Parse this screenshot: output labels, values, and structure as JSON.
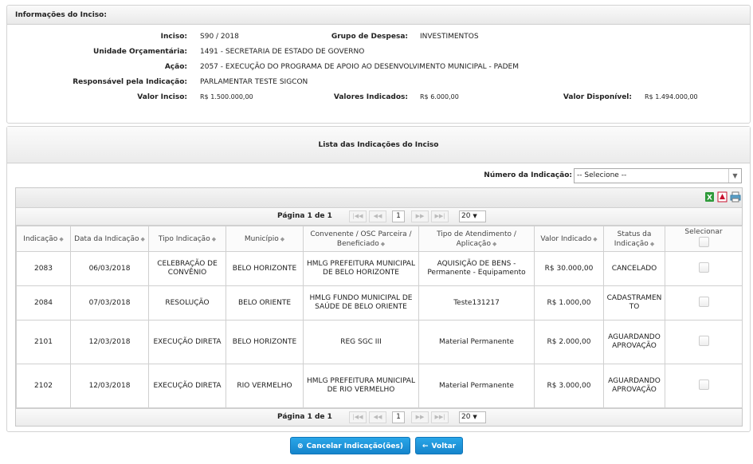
{
  "info": {
    "title": "Informações do Inciso:",
    "inciso_label": "Inciso:",
    "inciso_value": "S90 / 2018",
    "grupo_label": "Grupo de Despesa:",
    "grupo_value": "INVESTIMENTOS",
    "unidade_label": "Unidade Orçamentária:",
    "unidade_value": "1491 - SECRETARIA DE ESTADO DE GOVERNO",
    "acao_label": "Ação:",
    "acao_value": "2057 - EXECUÇÃO DO PROGRAMA DE APOIO AO DESENVOLVIMENTO MUNICIPAL - PADEM",
    "responsavel_label": "Responsável pela Indicação:",
    "responsavel_value": "PARLAMENTAR TESTE SIGCON",
    "valor_inciso_label": "Valor Inciso:",
    "valor_inciso_value": "R$ 1.500.000,00",
    "valores_indicados_label": "Valores Indicados:",
    "valores_indicados_value": "R$ 6.000,00",
    "valor_disponivel_label": "Valor Disponível:",
    "valor_disponivel_value": "R$ 1.494.000,00"
  },
  "list": {
    "title": "Lista das Indicações do Inciso",
    "filter_label": "Número da Indicação:",
    "filter_value": "-- Selecione --",
    "pager_text": "Página 1 de 1",
    "page_input": "1",
    "page_size": "20",
    "columns": [
      "Indicação",
      "Data da Indicação",
      "Tipo Indicação",
      "Município",
      "Convenente / OSC Parceira / Beneficiado",
      "Tipo de Atendimento / Aplicação",
      "Valor Indicado",
      "Status da Indicação",
      "Selecionar"
    ],
    "rows": [
      [
        "2083",
        "06/03/2018",
        "CELEBRAÇÃO DE CONVÊNIO",
        "BELO HORIZONTE",
        "HMLG PREFEITURA MUNICIPAL DE BELO HORIZONTE",
        "AQUISIÇÃO DE BENS - Permanente - Equipamento",
        "R$ 30.000,00",
        "CANCELADO"
      ],
      [
        "2084",
        "07/03/2018",
        "RESOLUÇÃO",
        "BELO ORIENTE",
        "HMLG FUNDO MUNICIPAL DE SAÚDE DE BELO ORIENTE",
        "Teste131217",
        "R$ 1.000,00",
        "CADASTRAMENTO"
      ],
      [
        "2101",
        "12/03/2018",
        "EXECUÇÃO DIRETA",
        "BELO HORIZONTE",
        "REG SGC III",
        "Material Permanente",
        "R$ 2.000,00",
        "AGUARDANDO APROVAÇÃO"
      ],
      [
        "2102",
        "12/03/2018",
        "EXECUÇÃO DIRETA",
        "RIO VERMELHO",
        "HMLG PREFEITURA MUNICIPAL DE RIO VERMELHO",
        "Material Permanente",
        "R$ 3.000,00",
        "AGUARDANDO APROVAÇÃO"
      ]
    ]
  },
  "buttons": {
    "cancel": "Cancelar Indicação(ões)",
    "back": "Voltar"
  },
  "icons": {
    "excel": "excel-icon",
    "pdf": "pdf-icon",
    "print": "print-icon",
    "first": "first-page-icon",
    "prev": "prev-page-icon",
    "next": "next-page-icon",
    "last": "last-page-icon"
  },
  "colors": {
    "button": "#1c8fd6",
    "panel_border": "#d3d3d3"
  }
}
